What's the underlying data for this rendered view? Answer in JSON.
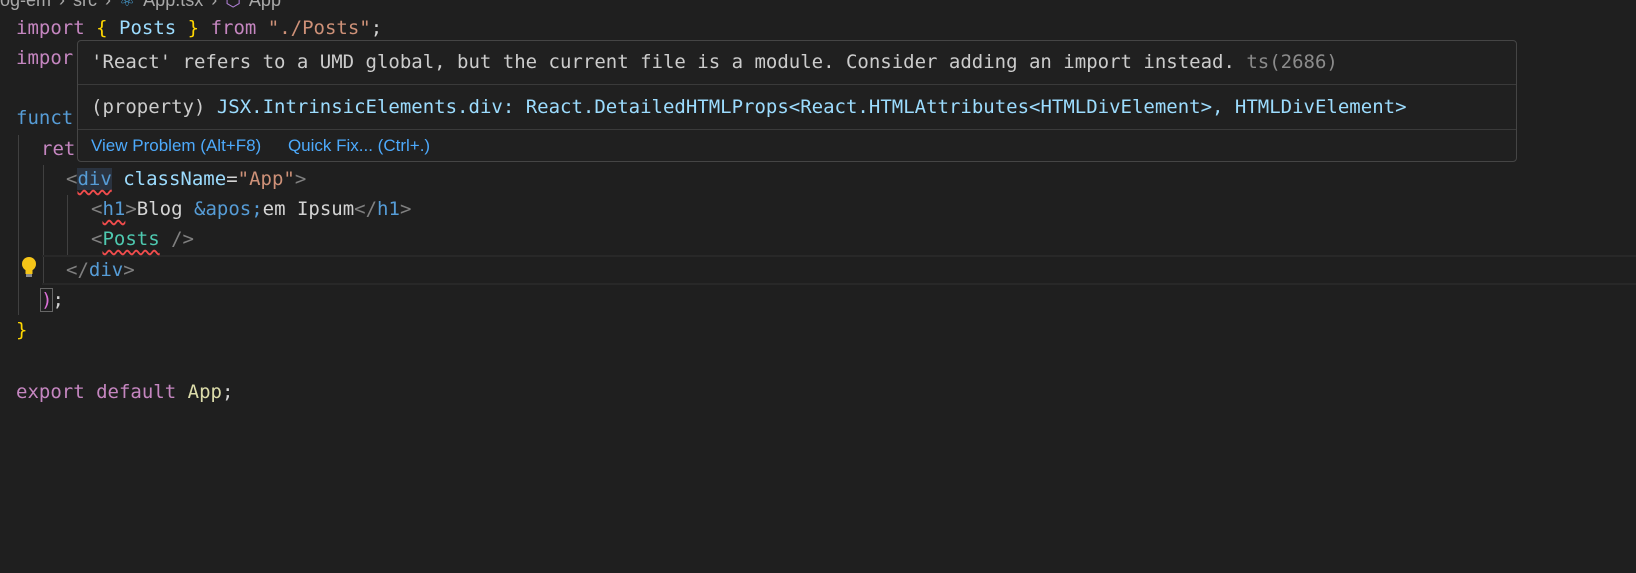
{
  "breadcrumb": {
    "items": [
      "og-em",
      "src",
      "App.tsx",
      "App"
    ],
    "separator": "›"
  },
  "code": {
    "l1": {
      "kw": "import",
      "open": "{",
      "name": "Posts",
      "close": "}",
      "from": "from",
      "path": "\"./Posts\"",
      "end": ";"
    },
    "l2": {
      "kw": "impor"
    },
    "l4": {
      "kw": "funct"
    },
    "l5": {
      "kw": "ret"
    },
    "l6": {
      "lt": "<",
      "tag": "div",
      "attr": "className",
      "eq": "=",
      "val": "\"App\"",
      "gt": ">"
    },
    "l7": {
      "lt": "<",
      "tag": "h1",
      "gt": ">",
      "text1": "Blog ",
      "entity": "&apos;",
      "text2": "em Ipsum",
      "close_lt": "</",
      "close_tag": "h1",
      "close_gt": ">"
    },
    "l8": {
      "lt": "<",
      "comp": "Posts",
      "end": " />"
    },
    "l9": {
      "lt": "</",
      "tag": "div",
      "gt": ">"
    },
    "l10": {
      "paren": ")",
      "semi": ";"
    },
    "l11": {
      "brace": "}"
    },
    "l13": {
      "kw1": "export",
      "kw2": "default",
      "name": "App",
      "end": ";"
    }
  },
  "hover": {
    "problem": "'React' refers to a UMD global, but the current file is a module. Consider adding an import instead.",
    "problem_code": "ts(2686)",
    "sig_prefix": "(property) ",
    "sig_name": "JSX.IntrinsicElements.div",
    "sig_rest": ": React.DetailedHTMLProps<React.HTMLAttributes<HTMLDivElement>, HTMLDivElement>",
    "view_problem": "View Problem (Alt+F8)",
    "quick_fix": "Quick Fix... (Ctrl+.)"
  },
  "colors": {
    "background": "#1f1f1f",
    "error": "#f14c4c",
    "link": "#4daafc",
    "lightbulb": "#f5c518"
  },
  "icons": [
    "react-file-icon",
    "symbol-cube-icon",
    "lightbulb-icon"
  ]
}
